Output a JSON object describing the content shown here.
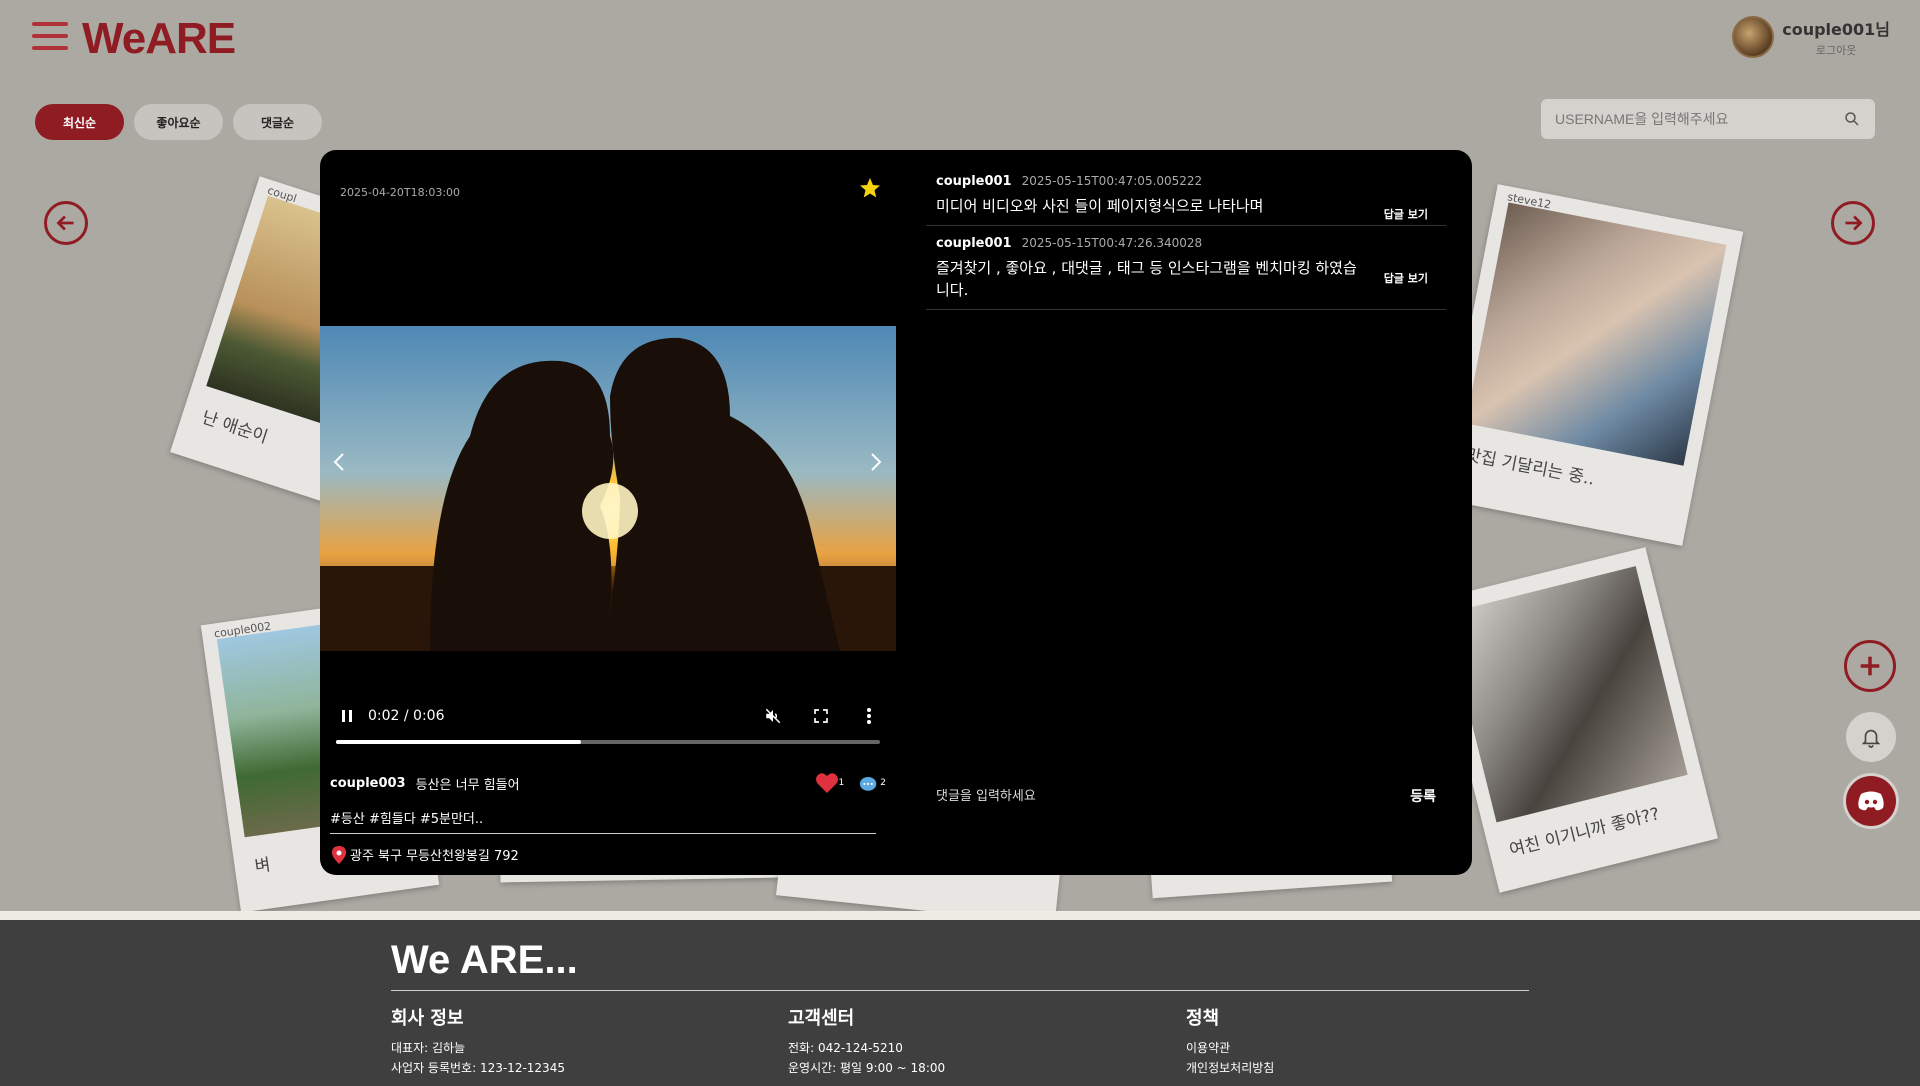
{
  "header": {
    "logo": "WeARE",
    "user_name": "couple001님",
    "logout": "로그아웃"
  },
  "sort_tabs": [
    "최신순",
    "좋아요순",
    "댓글순"
  ],
  "search": {
    "placeholder": "USERNAME을 입력해주세요"
  },
  "polaroids": [
    {
      "user": "coupl",
      "caption": "난 애순이"
    },
    {
      "user": "steve12",
      "caption": "맛집 기달리는 중.."
    },
    {
      "user": "couple002",
      "caption": "벼"
    },
    {
      "user": "",
      "caption": "여친 이기니까 좋아??"
    }
  ],
  "modal": {
    "date": "2025-04-20T18:03:00",
    "video": {
      "time": "0:02 / 0:06",
      "progress": 0.45
    },
    "post": {
      "user": "couple003",
      "text": "등산은 너무 힘들어",
      "likes": "1",
      "comments": "2",
      "tags": "#등산 #힘들다 #5분만더..",
      "location": "광주 북구 무등산천왕봉길 792"
    },
    "comments": [
      {
        "user": "couple001",
        "time": "2025-05-15T00:47:05.005222",
        "text": "미디어 비디오와 사진 들이 페이지형식으로 나타나며",
        "reply": "답글 보기"
      },
      {
        "user": "couple001",
        "time": "2025-05-15T00:47:26.340028",
        "text": "즐겨찾기 , 좋아요 , 대댓글 , 태그 등 인스타그램을 벤치마킹 하였습니다.",
        "reply": "답글 보기"
      }
    ],
    "comment_input": {
      "placeholder": "댓글을 입력하세요",
      "submit": "등록"
    }
  },
  "footer": {
    "title": "We ARE...",
    "company": {
      "heading": "회사 정보",
      "ceo": "대표자: 김하늘",
      "biz_no": "사업자 등록번호: 123-12-12345"
    },
    "support": {
      "heading": "고객센터",
      "phone": "전화: 042-124-5210",
      "hours": "운영시간: 평일 9:00 ~ 18:00"
    },
    "policy": {
      "heading": "정책",
      "terms": "이용약관",
      "privacy": "개인정보처리방침"
    }
  },
  "colors": {
    "brand": "#8f1c22",
    "background": "#aca9a3",
    "modal": "#000000",
    "footer": "#3f3f3f"
  },
  "icons": [
    "hamburger-icon",
    "search-icon",
    "arrow-left-icon",
    "arrow-right-icon",
    "star-icon",
    "pause-icon",
    "mute-icon",
    "fullscreen-icon",
    "more-icon",
    "heart-icon",
    "comment-icon",
    "location-pin-icon",
    "plus-icon",
    "bell-icon",
    "discord-icon"
  ]
}
